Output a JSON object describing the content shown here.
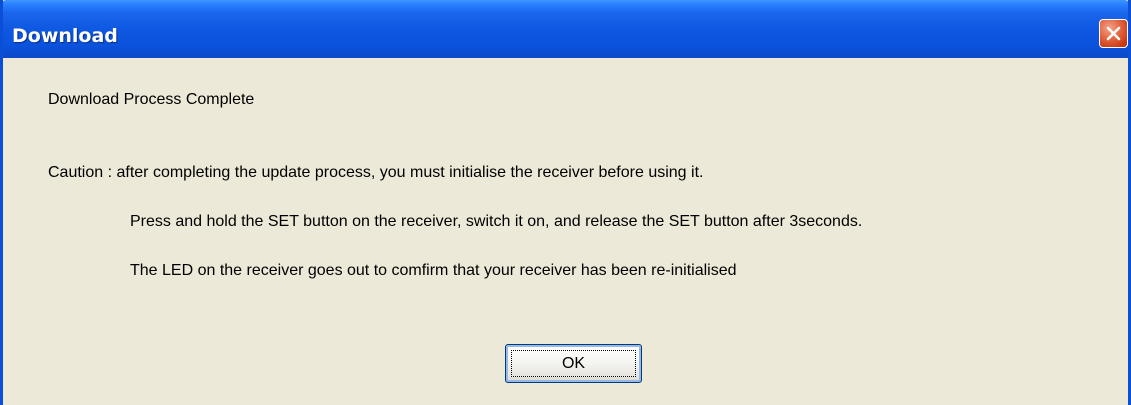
{
  "window": {
    "title": "Download",
    "close_icon": "close-icon",
    "accent_color": "#0a4fd6",
    "close_color": "#d8461e"
  },
  "dialog": {
    "heading": "Download Process Complete",
    "caution": "Caution : after completing the update process, you must initialise the receiver before using it.",
    "instruction": "Press and hold the SET button on the receiver, switch it on, and release the SET button after 3seconds.",
    "confirmation": "The LED on the receiver goes out to comfirm that your receiver has been re-initialised",
    "ok_label": "OK"
  }
}
